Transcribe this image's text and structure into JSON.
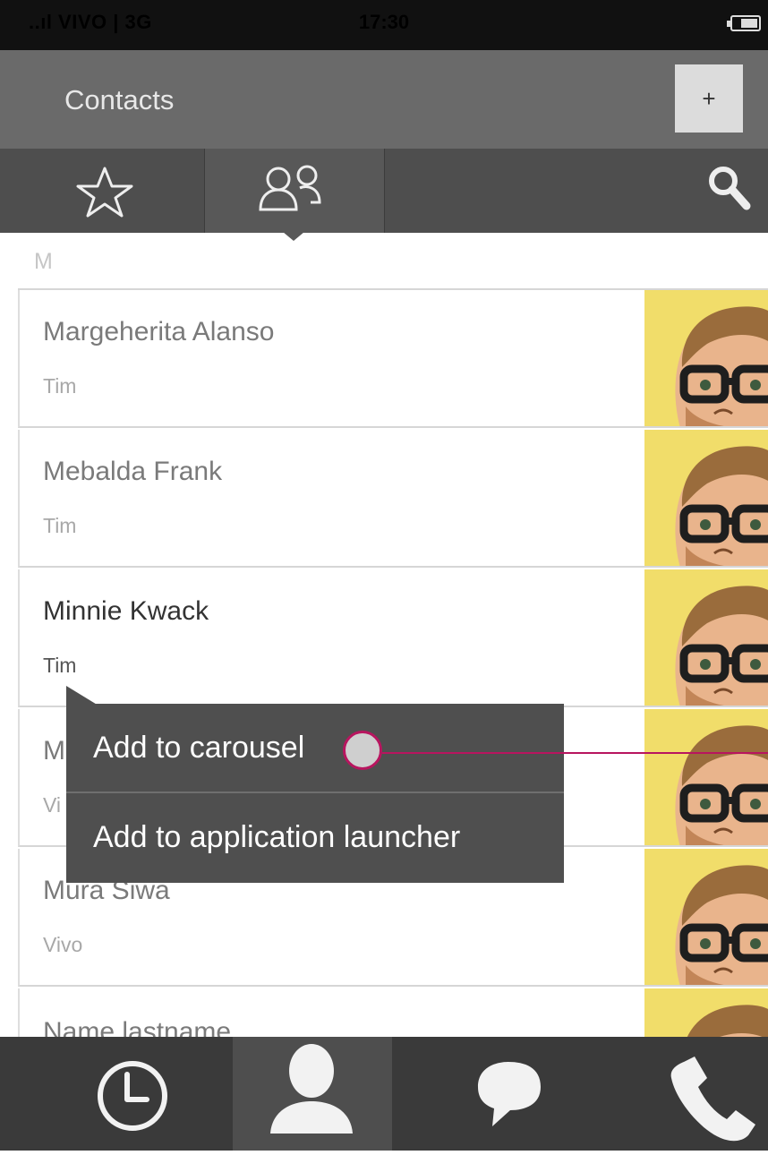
{
  "status_bar": {
    "carrier": "..ıl VIVO | 3G",
    "time": "17:30"
  },
  "header": {
    "title": "Contacts",
    "add_label": "+"
  },
  "tabs": [
    {
      "id": "favorites",
      "icon": "star-icon"
    },
    {
      "id": "contacts",
      "icon": "people-icon",
      "selected": true
    },
    {
      "id": "search",
      "icon": "search-icon"
    }
  ],
  "list": {
    "section_letter": "M",
    "contacts": [
      {
        "name": "Margeherita Alanso",
        "sub": "Tim"
      },
      {
        "name": "Mebalda Frank",
        "sub": "Tim"
      },
      {
        "name": "Minnie Kwack",
        "sub": "Tim"
      },
      {
        "name": "M",
        "sub": "Vi"
      },
      {
        "name": "Mura Siwa",
        "sub": "Vivo"
      },
      {
        "name": "Name lastname",
        "sub": ""
      }
    ]
  },
  "context_menu": {
    "items": [
      "Add to carousel",
      "Add to application launcher"
    ]
  },
  "bottom_nav": [
    {
      "id": "recents",
      "icon": "clock-icon"
    },
    {
      "id": "contacts",
      "icon": "person-icon",
      "selected": true
    },
    {
      "id": "messages",
      "icon": "chat-bubble-icon"
    },
    {
      "id": "phone",
      "icon": "phone-icon"
    }
  ],
  "colors": {
    "header_bg": "#6a6a6a",
    "tabs_bg": "#4e4e4e",
    "bottom_bar_bg": "#3a3a3a",
    "menu_bg": "#4f4f4f",
    "annotation": "#b8155f",
    "photo_bg": "#f1dd6a"
  }
}
